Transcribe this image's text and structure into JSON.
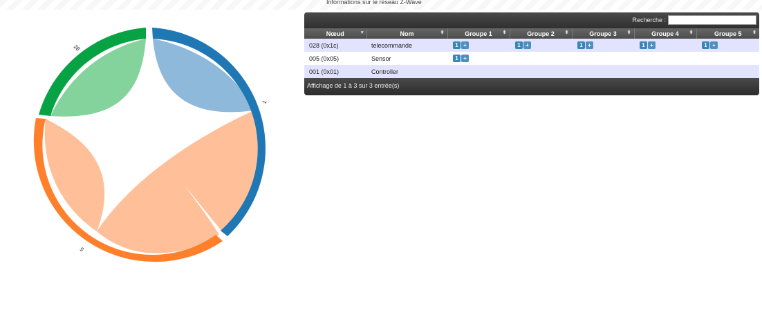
{
  "page": {
    "title": "Informations sur le réseau Z-Wave"
  },
  "chord": {
    "groups": [
      {
        "label": "1",
        "color": "#1f77b4",
        "ribbon": "#8fb9da"
      },
      {
        "label": "5",
        "color": "#ff7f2a",
        "ribbon": "#ffbf99"
      },
      {
        "label": "28",
        "color": "#07a243",
        "ribbon": "#84d29c"
      }
    ]
  },
  "search": {
    "label": "Recherche :",
    "value": ""
  },
  "table": {
    "headers": [
      "Nœud",
      "Nom",
      "Groupe 1",
      "Groupe 2",
      "Groupe 3",
      "Groupe 4",
      "Groupe 5"
    ],
    "rows": [
      {
        "node": "028 (0x1c)",
        "name": "telecommande",
        "groups": [
          [
            "1",
            "+"
          ],
          [
            "1",
            "+"
          ],
          [
            "1",
            "+"
          ],
          [
            "1",
            "+"
          ],
          [
            "1",
            "+"
          ]
        ]
      },
      {
        "node": "005 (0x05)",
        "name": "Sensor",
        "groups": [
          [
            "1",
            "+"
          ],
          [],
          [],
          [],
          []
        ]
      },
      {
        "node": "001 (0x01)",
        "name": "Controller",
        "groups": [
          [],
          [],
          [],
          [],
          []
        ]
      }
    ],
    "footer": "Affichage de 1 à 3 sur 3 entrée(s)"
  }
}
